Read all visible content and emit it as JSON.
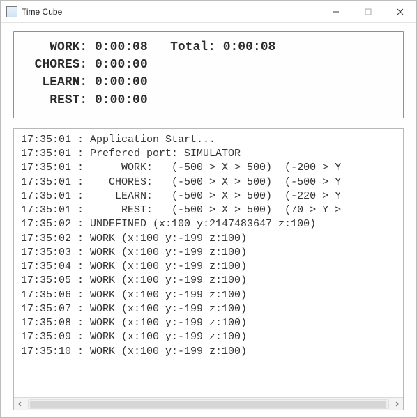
{
  "window": {
    "title": "Time Cube"
  },
  "summary": {
    "work_label": "WORK:",
    "work_value": "0:00:08",
    "total_label": "Total:",
    "total_value": "0:00:08",
    "chores_label": "CHORES:",
    "chores_value": "0:00:00",
    "learn_label": "LEARN:",
    "learn_value": "0:00:00",
    "rest_label": "REST:",
    "rest_value": "0:00:00"
  },
  "log": {
    "lines": [
      "17:35:01 : Application Start...",
      "17:35:01 : Prefered port: SIMULATOR",
      "17:35:01 :      WORK:   (-500 > X > 500)  (-200 > Y",
      "17:35:01 :    CHORES:   (-500 > X > 500)  (-500 > Y",
      "17:35:01 :     LEARN:   (-500 > X > 500)  (-220 > Y",
      "17:35:01 :      REST:   (-500 > X > 500)  (70 > Y >",
      "17:35:02 : UNDEFINED (x:100 y:2147483647 z:100)",
      "17:35:02 : WORK (x:100 y:-199 z:100)",
      "17:35:03 : WORK (x:100 y:-199 z:100)",
      "17:35:04 : WORK (x:100 y:-199 z:100)",
      "17:35:05 : WORK (x:100 y:-199 z:100)",
      "17:35:06 : WORK (x:100 y:-199 z:100)",
      "17:35:07 : WORK (x:100 y:-199 z:100)",
      "17:35:08 : WORK (x:100 y:-199 z:100)",
      "17:35:09 : WORK (x:100 y:-199 z:100)",
      "17:35:10 : WORK (x:100 y:-199 z:100)"
    ]
  }
}
